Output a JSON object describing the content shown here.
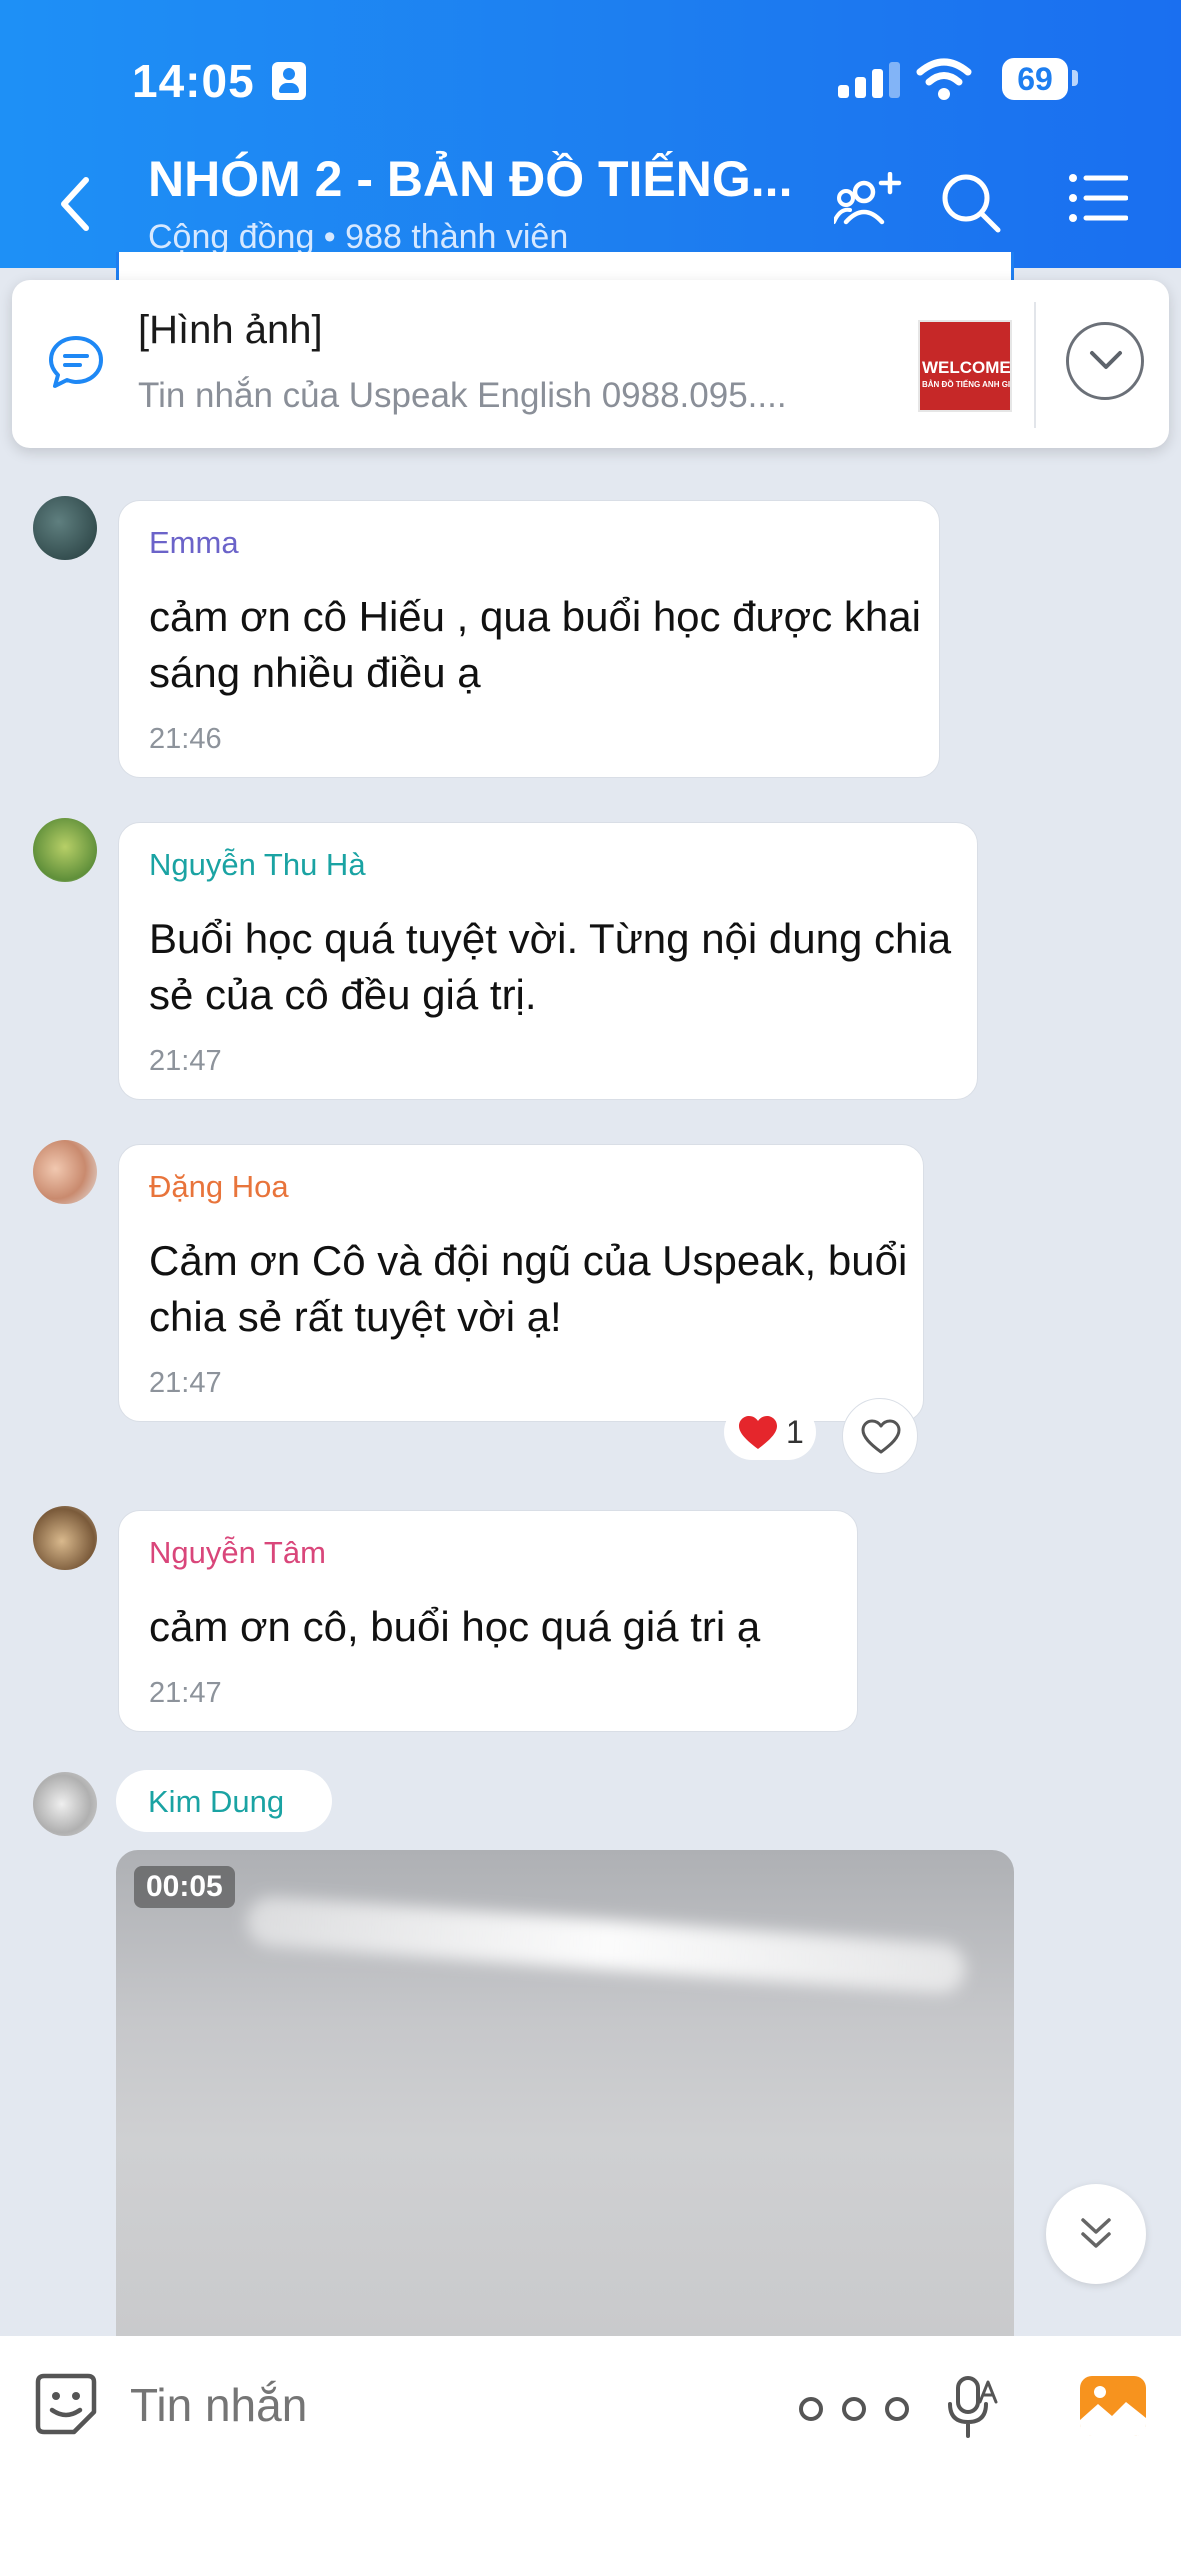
{
  "status_bar": {
    "time": "14:05",
    "battery": "69"
  },
  "header": {
    "title": "NHÓM 2 - BẢN ĐỒ TIẾNG...",
    "subtitle": "Cộng đồng • 988 thành viên"
  },
  "pinned": {
    "title": "[Hình ảnh]",
    "subtitle": "Tin nhắn của Uspeak English 0988.095....",
    "thumb_text_1": "WELCOME",
    "thumb_text_2": "BẢN ĐỒ TIẾNG ANH GI"
  },
  "messages": [
    {
      "sender": "Emma",
      "sender_color": "#6b63c9",
      "text": "cảm ơn cô Hiếu , qua buổi học được khai sáng nhiều điều ạ",
      "time": "21:46"
    },
    {
      "sender": "Nguyễn Thu Hà",
      "sender_color": "#1aa3a3",
      "text": "Buổi học quá tuyệt vời. Từng nội dung chia sẻ của cô đều giá trị.",
      "time": "21:47"
    },
    {
      "sender": "Đặng Hoa",
      "sender_color": "#e8743b",
      "text": "Cảm ơn Cô và đội ngũ của Uspeak, buổi chia sẻ rất tuyệt vời ạ!",
      "time": "21:47",
      "reaction_count": "1"
    },
    {
      "sender": "Nguyễn Tâm",
      "sender_color": "#d9467a",
      "text": "cảm ơn cô, buổi học quá giá tri ạ",
      "time": "21:47"
    },
    {
      "sender": "Kim Dung",
      "sender_color": "#1aa3a3",
      "video_duration": "00:05"
    }
  ],
  "composer": {
    "placeholder": "Tin nhắn"
  },
  "icons": {
    "back": "chevron-left-icon",
    "add_member": "add-member-icon",
    "search": "search-icon",
    "menu": "list-menu-icon",
    "pinned": "chat-bubble-icon",
    "expand": "chevron-down-icon",
    "like": "heart-outline-icon",
    "reaction": "heart-icon",
    "scroll": "double-chevron-down-icon",
    "sticker": "sticker-icon",
    "more": "more-icon",
    "mic": "mic-icon",
    "gallery": "image-icon"
  },
  "colors": {
    "header": "#1e88f5",
    "background": "#e3e8f0",
    "reaction_heart": "#e5262c"
  }
}
